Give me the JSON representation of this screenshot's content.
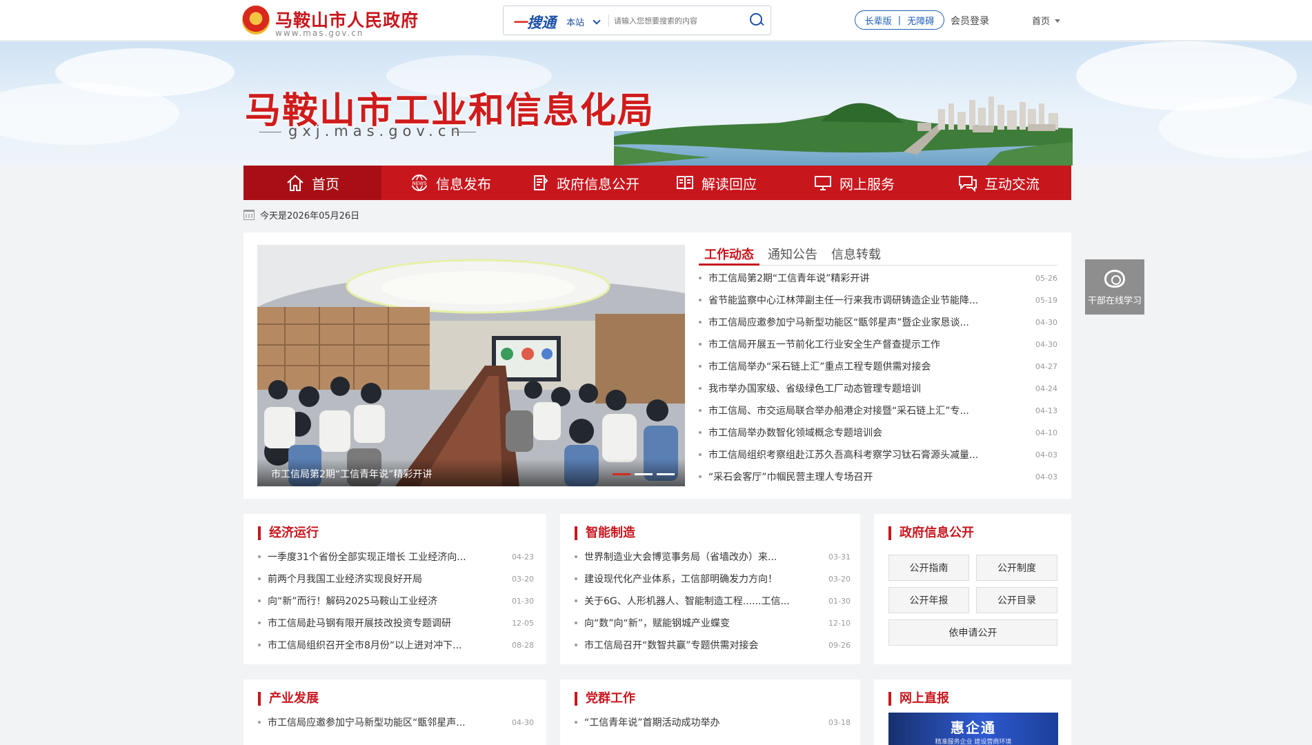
{
  "header": {
    "site_title": "马鞍山市人民政府",
    "site_url": "www.mas.gov.cn",
    "search_brand_a": "一",
    "search_brand_b": "搜通",
    "search_scope": "本站",
    "search_placeholder": "请输入您想要搜索的内容",
    "elder_mode": "长辈版",
    "accessibility": "无障碍",
    "login": "会员登录",
    "home_menu": "首页"
  },
  "banner": {
    "title": "马鞍山市工业和信息化局",
    "url": "gxj.mas.gov.cn"
  },
  "nav": {
    "items": [
      {
        "label": "首页",
        "icon": "home-icon"
      },
      {
        "label": "信息发布",
        "icon": "news-icon"
      },
      {
        "label": "政府信息公开",
        "icon": "document-icon"
      },
      {
        "label": "解读回应",
        "icon": "book-icon"
      },
      {
        "label": "网上服务",
        "icon": "monitor-icon"
      },
      {
        "label": "互动交流",
        "icon": "chat-icon"
      }
    ]
  },
  "date_text": "今天是2026年05月26日",
  "slider": {
    "caption": "市工信局第2期“工信青年说”精彩开讲"
  },
  "news": {
    "tabs": [
      "工作动态",
      "通知公告",
      "信息转载"
    ],
    "items": [
      {
        "title": "市工信局第2期“工信青年说”精彩开讲",
        "date": "05-26"
      },
      {
        "title": "省节能监察中心江林萍副主任一行来我市调研铸造企业节能降...",
        "date": "05-19"
      },
      {
        "title": "市工信局应邀参加宁马新型功能区“甑邻星声”暨企业家恳谈...",
        "date": "04-30"
      },
      {
        "title": "市工信局开展五一节前化工行业安全生产督查提示工作",
        "date": "04-30"
      },
      {
        "title": "市工信局举办“采石链上汇”重点工程专题供需对接会",
        "date": "04-27"
      },
      {
        "title": "我市举办国家级、省级绿色工厂动态管理专题培训",
        "date": "04-24"
      },
      {
        "title": "市工信局、市交运局联合举办船港企对接暨“采石链上汇”专...",
        "date": "04-13"
      },
      {
        "title": "市工信局举办数智化领域概念专题培训会",
        "date": "04-10"
      },
      {
        "title": "市工信局组织考察组赴江苏久吾高科考察学习钛石膏源头减量...",
        "date": "04-03"
      },
      {
        "title": "“采石会客厅”巾帼民营主理人专场召开",
        "date": "04-03"
      }
    ]
  },
  "float_widget": {
    "label": "干部在线学习"
  },
  "panels": {
    "economy": {
      "title": "经济运行",
      "items": [
        {
          "title": "一季度31个省份全部实现正增长 工业经济向...",
          "date": "04-23"
        },
        {
          "title": "前两个月我国工业经济实现良好开局",
          "date": "03-20"
        },
        {
          "title": "向“新”而行！解码2025马鞍山工业经济",
          "date": "01-30"
        },
        {
          "title": "市工信局赴马钢有限开展技改投资专题调研",
          "date": "12-05"
        },
        {
          "title": "市工信局组织召开全市8月份“以上进对冲下...",
          "date": "08-28"
        }
      ]
    },
    "smart": {
      "title": "智能制造",
      "items": [
        {
          "title": "世界制造业大会博览事务局（省墙改办）来...",
          "date": "03-31"
        },
        {
          "title": "建设现代化产业体系，工信部明确发力方向！",
          "date": "03-20"
        },
        {
          "title": "关于6G、人形机器人、智能制造工程......工信...",
          "date": "01-30"
        },
        {
          "title": "向“数”向“新”，赋能钢城产业蝶变",
          "date": "12-10"
        },
        {
          "title": "市工信局召开“数智共赢”专题供需对接会",
          "date": "09-26"
        }
      ]
    },
    "gov_open": {
      "title": "政府信息公开",
      "buttons": [
        "公开指南",
        "公开制度",
        "公开年报",
        "公开目录",
        "依申请公开"
      ]
    },
    "industry": {
      "title": "产业发展",
      "items": [
        {
          "title": "市工信局应邀参加宁马新型功能区“甑邻星声...",
          "date": "04-30"
        }
      ]
    },
    "party": {
      "title": "党群工作",
      "items": [
        {
          "title": "“工信青年说”首期活动成功举办",
          "date": "03-18"
        }
      ]
    },
    "report": {
      "title": "网上直报",
      "banner_title": "惠企通",
      "banner_sub": "精准服务企业 建设营商环境"
    }
  },
  "colors": {
    "primary": "#c8161d",
    "nav_active": "#a80f15",
    "accent_blue": "#1d50a8",
    "page_bg": "#f2f3f5"
  }
}
